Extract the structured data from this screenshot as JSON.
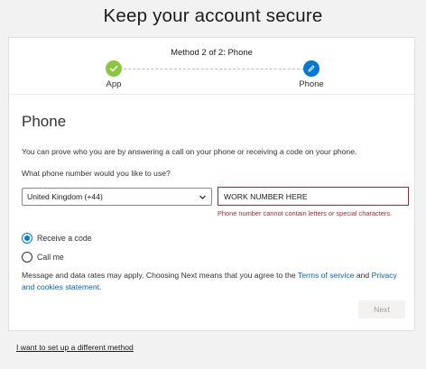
{
  "page": {
    "title": "Keep your account secure"
  },
  "stepper": {
    "method_label": "Method 2 of 2: Phone",
    "steps": [
      {
        "label": "App",
        "state": "complete",
        "icon": "checkmark-icon",
        "color": "#8cc63f"
      },
      {
        "label": "Phone",
        "state": "current",
        "icon": "pencil-icon",
        "color": "#0078d4"
      }
    ]
  },
  "form": {
    "section_title": "Phone",
    "intro": "You can prove who you are by answering a call on your phone or receiving a code on your phone.",
    "question": "What phone number would you like to use?",
    "country": {
      "selected": "United Kingdom (+44)",
      "icon": "chevron-down-icon"
    },
    "phone_number": {
      "value": "WORK NUMBER HERE",
      "error": "Phone number cannot contain letters or special characters.",
      "error_color": "#a4262c"
    },
    "methods": [
      {
        "label": "Receive a code",
        "checked": true
      },
      {
        "label": "Call me",
        "checked": false
      }
    ],
    "disclaimer": {
      "text_before": "Message and data rates may apply. Choosing Next means that you agree to the ",
      "terms_link": "Terms of service",
      "text_middle": " and ",
      "privacy_link": "Privacy and cookies statement",
      "text_after": "."
    },
    "next_label": "Next"
  },
  "footer": {
    "different_method_link": "I want to set up a different method"
  },
  "colors": {
    "accent": "#0078d4",
    "link": "#0067b8",
    "success": "#8cc63f",
    "error": "#a4262c"
  }
}
